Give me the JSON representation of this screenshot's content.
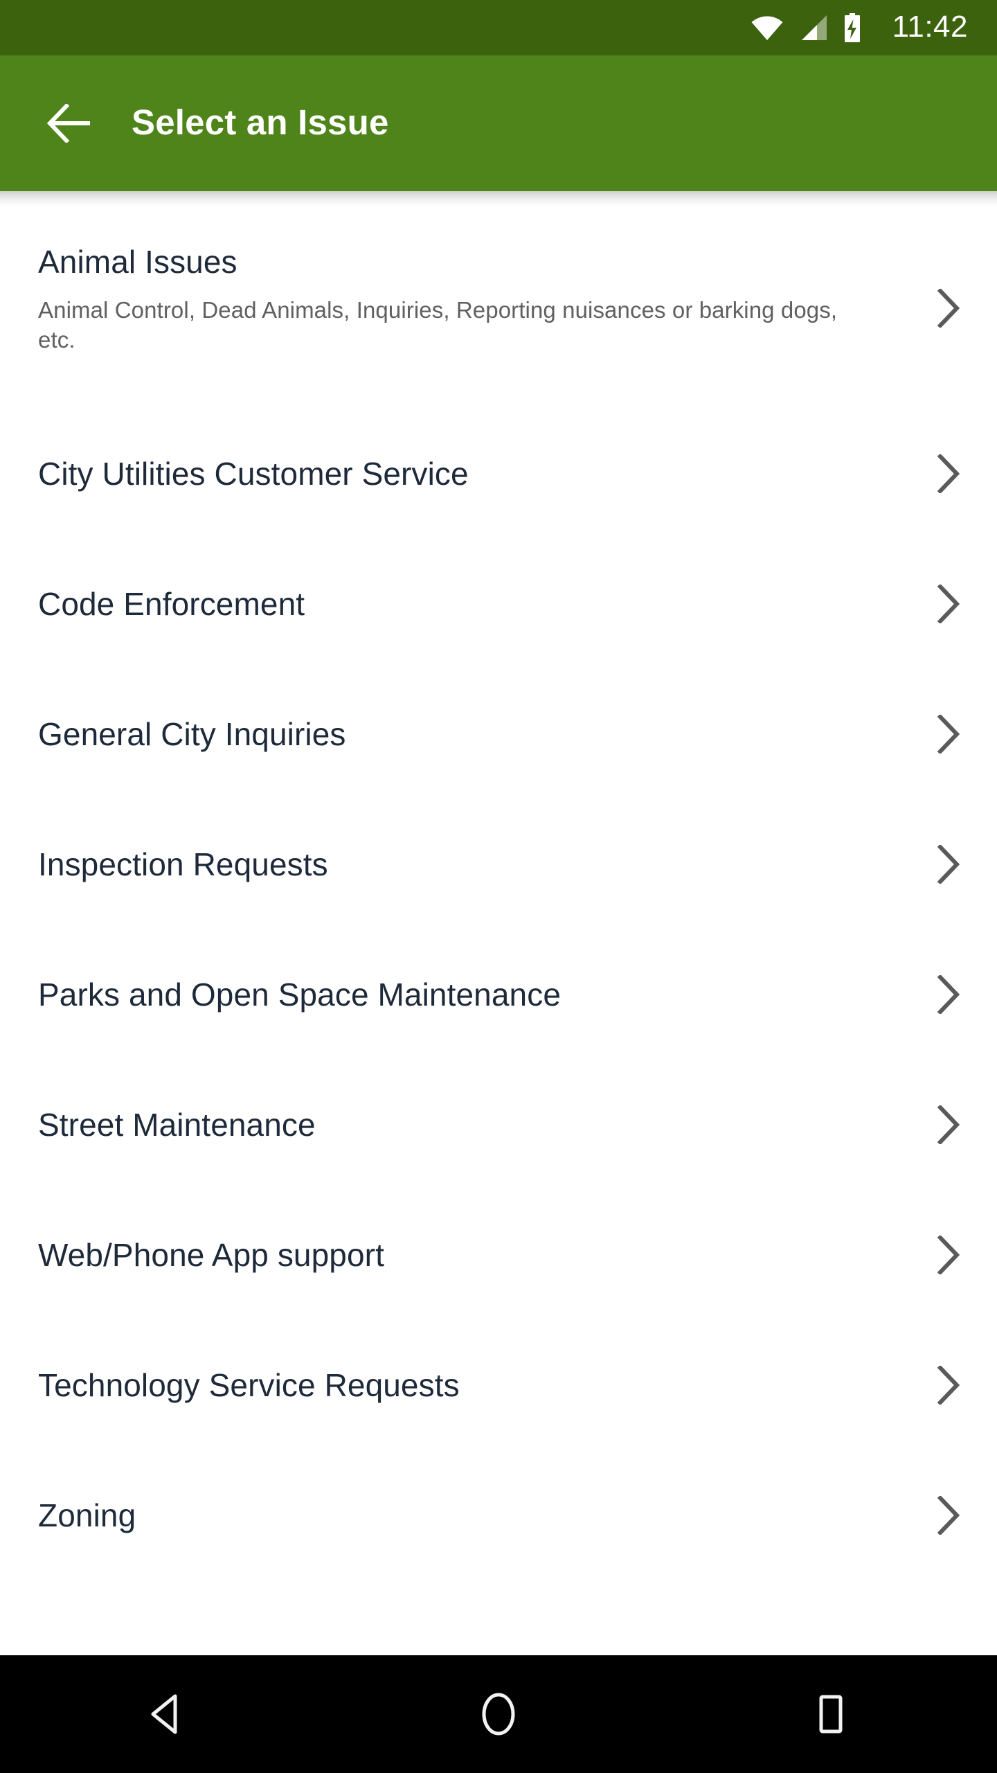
{
  "status_bar": {
    "time": "11:42",
    "icons": [
      "wifi-icon",
      "cellular-signal-icon",
      "battery-charging-icon"
    ],
    "background_color": "#3c620e",
    "foreground_color": "#ffffff"
  },
  "app_bar": {
    "title": "Select an Issue",
    "back_icon": "back-arrow-icon",
    "background_color": "#4e8419",
    "title_color": "#ffffff"
  },
  "colors": {
    "accent_green": "#4e8419",
    "status_green": "#3c620e",
    "title_text": "#1e2a3a",
    "subtitle_text": "#606060",
    "chevron": "#5a5a5a",
    "page_background": "#ffffff",
    "nav_bar": "#000000"
  },
  "list": {
    "items": [
      {
        "title": "Animal Issues",
        "subtitle": "Animal Control, Dead Animals, Inquiries, Reporting nuisances or barking dogs, etc.",
        "chevron": "chevron-right-icon"
      },
      {
        "title": "City Utilities Customer Service",
        "subtitle": "",
        "chevron": "chevron-right-icon"
      },
      {
        "title": "Code Enforcement",
        "subtitle": "",
        "chevron": "chevron-right-icon"
      },
      {
        "title": "General City Inquiries",
        "subtitle": "",
        "chevron": "chevron-right-icon"
      },
      {
        "title": "Inspection Requests",
        "subtitle": "",
        "chevron": "chevron-right-icon"
      },
      {
        "title": "Parks and Open Space Maintenance",
        "subtitle": "",
        "chevron": "chevron-right-icon"
      },
      {
        "title": "Street Maintenance",
        "subtitle": "",
        "chevron": "chevron-right-icon"
      },
      {
        "title": "Web/Phone App support",
        "subtitle": "",
        "chevron": "chevron-right-icon"
      },
      {
        "title": "Technology Service Requests",
        "subtitle": "",
        "chevron": "chevron-right-icon"
      },
      {
        "title": "Zoning",
        "subtitle": "",
        "chevron": "chevron-right-icon"
      }
    ]
  },
  "nav_bar": {
    "buttons": [
      {
        "name": "back-triangle-icon"
      },
      {
        "name": "home-circle-icon"
      },
      {
        "name": "recents-square-icon"
      }
    ]
  }
}
